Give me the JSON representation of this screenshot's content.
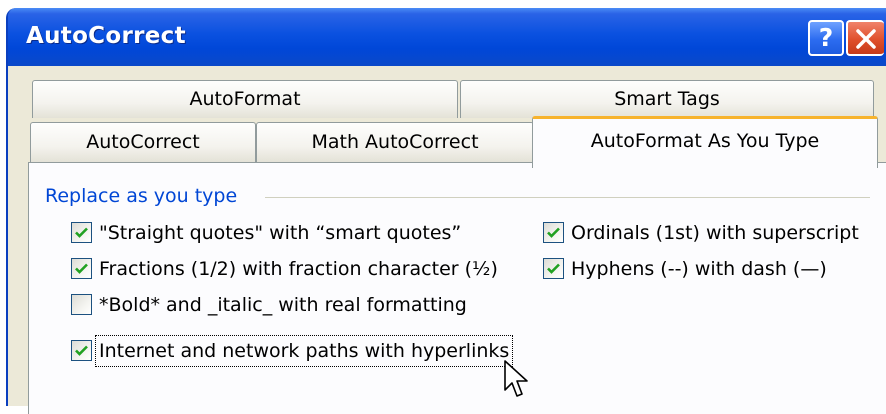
{
  "window": {
    "title": "AutoCorrect",
    "help_label": "?",
    "close_icon": "close-icon"
  },
  "tabs": {
    "back_row": [
      "AutoFormat",
      "Smart Tags"
    ],
    "front_row": [
      "AutoCorrect",
      "Math AutoCorrect",
      "AutoFormat As You Type"
    ],
    "active": "AutoFormat As You Type"
  },
  "group": {
    "label": "Replace as you type",
    "options": [
      {
        "label": "\"Straight quotes\" with “smart quotes”",
        "checked": true
      },
      {
        "label": "Fractions (1/2) with fraction character (½)",
        "checked": true
      },
      {
        "label": "*Bold* and _italic_ with real formatting",
        "checked": false
      },
      {
        "label": "Internet and network paths with hyperlinks",
        "checked": true,
        "focused": true
      },
      {
        "label": "Ordinals (1st) with superscript",
        "checked": true
      },
      {
        "label": "Hyphens (--) with dash (—)",
        "checked": true
      }
    ]
  },
  "colors": {
    "titlebar": "#0047d8",
    "group_label": "#0046d5",
    "checkmark": "#21a121",
    "active_tab_accent": "#f7b32d"
  }
}
